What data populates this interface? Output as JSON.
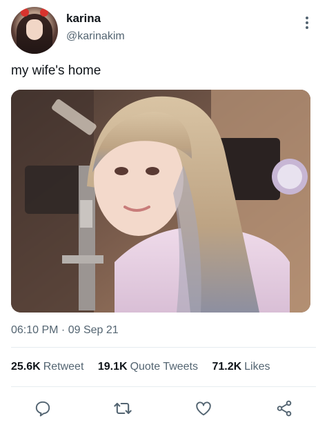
{
  "tweet": {
    "author_name": "karina",
    "author_handle": "@karinakim",
    "text": "my wife's home",
    "timestamp": "06:10 PM · 09 Sep 21",
    "stats": [
      {
        "count": "25.6K",
        "label": "Retweet"
      },
      {
        "count": "19.1K",
        "label": "Quote Tweets"
      },
      {
        "count": "71.2K",
        "label": "Likes"
      }
    ]
  },
  "icons": {
    "more": "more-vertical-icon",
    "reply": "reply-icon",
    "retweet": "retweet-icon",
    "like": "heart-icon",
    "share": "share-icon"
  },
  "colors": {
    "text_primary": "#0f1419",
    "text_secondary": "#536471",
    "divider": "#e6ecf0"
  }
}
